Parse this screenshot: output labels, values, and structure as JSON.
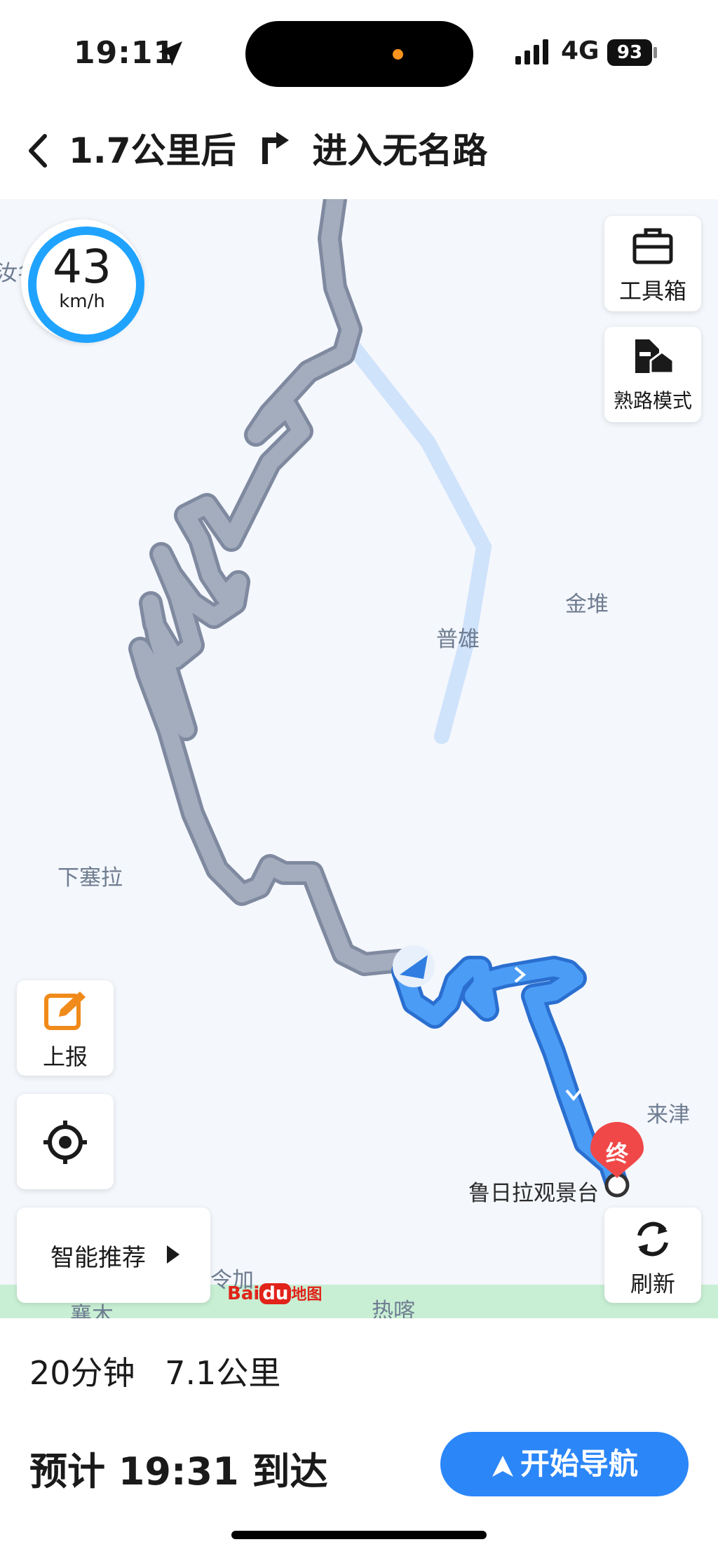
{
  "status": {
    "time": "19:11",
    "network": "4G",
    "battery": "93"
  },
  "header": {
    "instruction": "1.7公里后",
    "road": "进入无名路"
  },
  "map": {
    "speed": {
      "value": "43",
      "unit": "km/h"
    },
    "places": {
      "jindui": "金堆",
      "puxiong": "普雄",
      "xiasaila": "下塞拉",
      "laijin": "来津",
      "destination": "鲁日拉观景台",
      "reka": "热喀",
      "xiangmu": "襄木",
      "linjiao": "令加",
      "left_cut": "汝名"
    },
    "end_marker": "终",
    "logo": {
      "bai": "Bai",
      "du": "du",
      "ditu": "地图"
    }
  },
  "controls": {
    "toolbox": "工具箱",
    "familiar_mode": "熟路模式",
    "report": "上报",
    "smart": "智能推荐",
    "refresh": "刷新"
  },
  "route": {
    "duration": "20分钟",
    "distance": "7.1公里",
    "eta_prefix": "预计",
    "eta_time": "19:31",
    "eta_suffix": "到达"
  },
  "actions": {
    "start_nav": "开始导航"
  },
  "colors": {
    "route_active": "#3d8ff0",
    "route_passed": "#98a2b3",
    "river": "#cfe3fb",
    "button": "#2b86f8",
    "end_pin": "#f04848"
  }
}
